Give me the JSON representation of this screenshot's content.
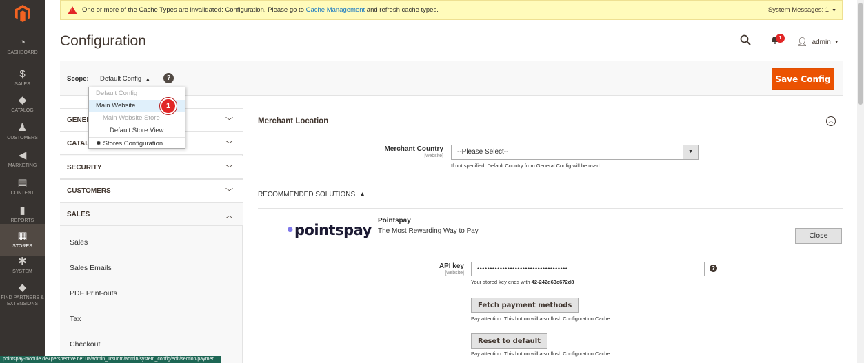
{
  "nav": {
    "items": [
      {
        "label": "DASHBOARD",
        "icon": "dashboard-icon",
        "glyph": "◔"
      },
      {
        "label": "SALES",
        "icon": "dollar-icon",
        "glyph": "$"
      },
      {
        "label": "CATALOG",
        "icon": "cube-icon",
        "glyph": "◆"
      },
      {
        "label": "CUSTOMERS",
        "icon": "person-icon",
        "glyph": "♟"
      },
      {
        "label": "MARKETING",
        "icon": "megaphone-icon",
        "glyph": "◀"
      },
      {
        "label": "CONTENT",
        "icon": "layout-icon",
        "glyph": "▤"
      },
      {
        "label": "REPORTS",
        "icon": "bar-chart-icon",
        "glyph": "▮"
      },
      {
        "label": "STORES",
        "icon": "store-icon",
        "glyph": "▦"
      },
      {
        "label": "SYSTEM",
        "icon": "gear-icon",
        "glyph": "✱"
      },
      {
        "label": "FIND PARTNERS & EXTENSIONS",
        "icon": "cube-icon",
        "glyph": "◆"
      }
    ]
  },
  "message": {
    "text_before": "One or more of the Cache Types are invalidated: Configuration. Please go to ",
    "link": "Cache Management",
    "text_after": " and refresh cache types.",
    "system_messages": "System Messages: 1"
  },
  "header": {
    "title": "Configuration",
    "notifications": "1",
    "user": "admin"
  },
  "scope": {
    "label": "Scope:",
    "value": "Default Config",
    "help": "?",
    "save": "Save Config",
    "options": [
      {
        "label": "Default Config",
        "state": "disabled"
      },
      {
        "label": "Main Website",
        "state": "highlighted"
      },
      {
        "label": "Main Website Store",
        "state": "disabled"
      },
      {
        "label": "Default Store View",
        "state": "normal"
      },
      {
        "label": "Stores Configuration",
        "state": "normal"
      }
    ],
    "step_badge": "1"
  },
  "tabs": {
    "headers": [
      "GENERAL",
      "CATALOG",
      "SECURITY",
      "CUSTOMERS",
      "SALES"
    ],
    "sales_items": [
      "Sales",
      "Sales Emails",
      "PDF Print-outs",
      "Tax",
      "Checkout"
    ]
  },
  "content": {
    "section_title": "Merchant Location",
    "merchant_country_label": "Merchant Country",
    "merchant_country_scope": "[website]",
    "merchant_country_value": "--Please Select--",
    "merchant_country_note": "If not specified, Default Country from General Config will be used.",
    "recommended": "RECOMMENDED SOLUTIONS: ▲",
    "pointspay": {
      "logo_dot": "•",
      "logo_text": "pointspay",
      "name": "Pointspay",
      "tagline": "The Most Rewarding Way to Pay",
      "close": "Close",
      "api_label": "API key",
      "api_scope": "[website]",
      "api_value": "••••••••••••••••••••••••••••••••••••",
      "stored_prefix": "Your stored key ends with ",
      "stored_suffix": "42-242d63c672d8",
      "fetch": "Fetch payment methods",
      "fetch_note": "Pay attention: This button will also flush Configuration Cache",
      "reset": "Reset to default",
      "reset_note": "Pay attention: This button will also flush Configuration Cache"
    }
  },
  "statusbar": "pointspay-module.dev.perspective.net.ua/admin_1rsudm/admin/system_config/edit/section/paymen..."
}
